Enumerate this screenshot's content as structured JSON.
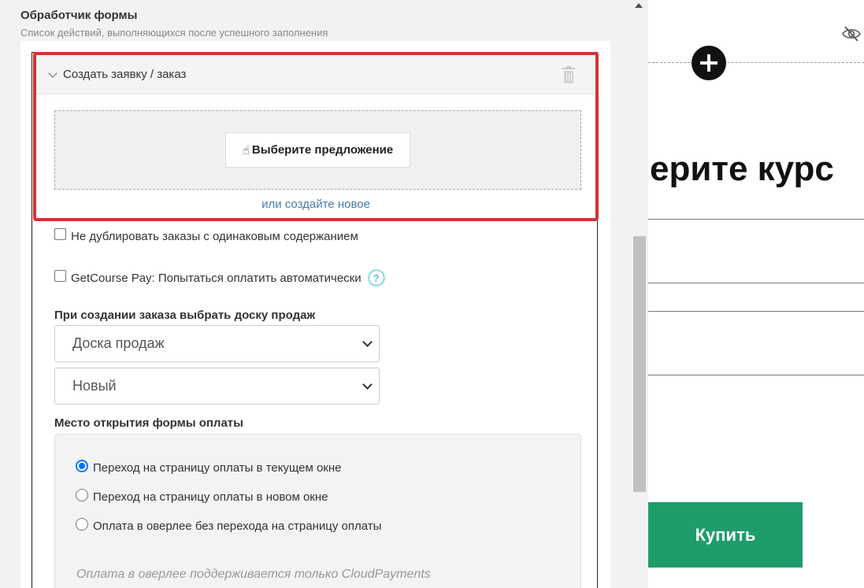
{
  "panel": {
    "title": "Обработчик формы",
    "subtitle": "Список действий, выполняющихся после успешного заполнения"
  },
  "order_block": {
    "title": "Создать заявку / заказ",
    "choose_button": "Выберите предложение",
    "hand_icon": "☝",
    "create_new_link": "или создайте новое"
  },
  "options": {
    "no_duplicate_label": "Не дублировать заказы с одинаковым содержанием",
    "no_duplicate_checked": false,
    "getcourse_pay_label": "GetCourse Pay: Попытаться оплатить автоматически",
    "getcourse_pay_checked": false,
    "help_icon": "?"
  },
  "sales_board": {
    "label": "При создании заказа выбрать доску продаж",
    "board_value": "Доска продаж",
    "stage_value": "Новый"
  },
  "payment_form": {
    "label": "Место открытия формы оплаты",
    "options": [
      {
        "label": "Переход на страницу оплаты в текущем окне",
        "checked": true
      },
      {
        "label": "Переход на страницу оплаты в новом окне",
        "checked": false
      },
      {
        "label": "Оплата в оверлее без перехода на страницу оплаты",
        "checked": false
      }
    ],
    "note": "Оплата в оверлее поддерживается только CloudPayments"
  },
  "preview": {
    "heading": "ерите курс",
    "buy_button": "Купить",
    "buy_color": "#1e9d6b"
  },
  "colors": {
    "highlight_border": "#d03434",
    "link": "#4a7ba7",
    "help_accent": "#4fc7d6",
    "radio_accent": "#0075ff"
  }
}
